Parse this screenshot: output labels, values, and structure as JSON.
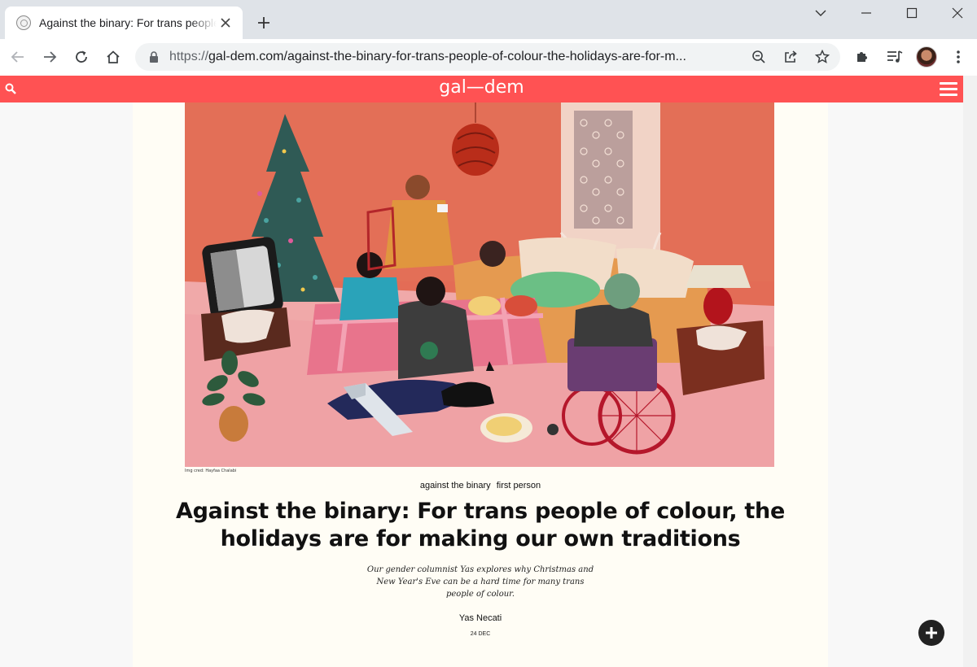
{
  "browser": {
    "tab_title": "Against the binary: For trans people of colour, the holidays are for making our own traditions",
    "new_tab_symbol": "+",
    "url_scheme": "https://",
    "url_rest": "gal-dem.com/against-the-binary-for-trans-people-of-colour-the-holidays-are-for-m...",
    "icons": [
      "favicon",
      "close-icon",
      "plus-icon",
      "chevron-down-icon",
      "minimize-icon",
      "maximize-icon",
      "close-window-icon",
      "back-arrow-icon",
      "forward-arrow-icon",
      "reload-icon",
      "home-icon",
      "lock-icon",
      "zoom-icon",
      "share-icon",
      "star-icon",
      "puzzle-icon",
      "media-icon",
      "avatar",
      "kebab-menu-icon"
    ]
  },
  "site": {
    "logo": "gal—dem",
    "brand_color": "#ff5253",
    "icons": [
      "search-icon",
      "hamburger-menu-icon",
      "chevron-down-icon"
    ]
  },
  "article": {
    "image_credit": "Img cred: Hayfaa Chalabi",
    "categories": [
      "against the binary",
      "first person"
    ],
    "headline": "Against the binary: For trans people of colour, the holidays are for making our own traditions",
    "standfirst": "Our gender columnist Yas explores why Christmas and New Year's Eve can be a hard time for many trans people of colour.",
    "author": "Yas Necati",
    "date": "24 DEC"
  },
  "fab": {
    "icon": "plus-icon"
  }
}
